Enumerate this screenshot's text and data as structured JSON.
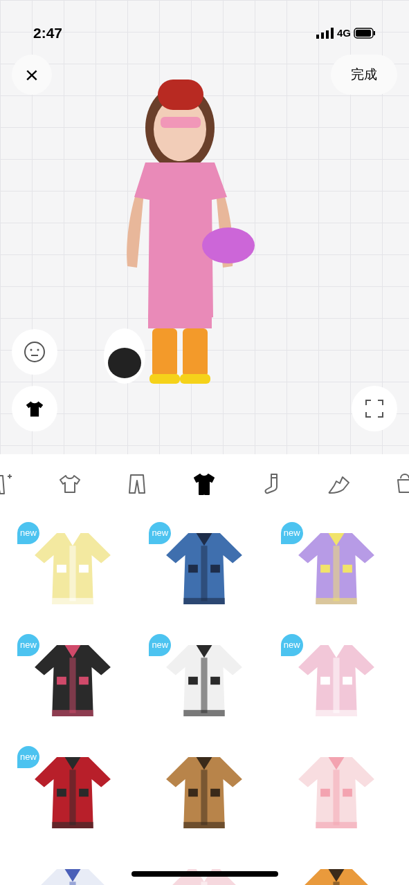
{
  "status_bar": {
    "time": "2:47",
    "network": "4G"
  },
  "top_bar": {
    "close": "×",
    "done": "完成"
  },
  "tabs": [
    {
      "kind": "set",
      "selected": false
    },
    {
      "kind": "shirt",
      "selected": false
    },
    {
      "kind": "pants",
      "selected": false
    },
    {
      "kind": "suit",
      "selected": true
    },
    {
      "kind": "sock",
      "selected": false
    },
    {
      "kind": "shoe",
      "selected": false
    },
    {
      "kind": "bag",
      "selected": false
    }
  ],
  "items": [
    {
      "new": true,
      "badge": "new"
    },
    {
      "new": true,
      "badge": "new"
    },
    {
      "new": true,
      "badge": "new"
    },
    {
      "new": true,
      "badge": "new"
    },
    {
      "new": true,
      "badge": "new"
    },
    {
      "new": true,
      "badge": "new"
    },
    {
      "new": true,
      "badge": "new"
    },
    {
      "new": false
    },
    {
      "new": false
    },
    {
      "new": false
    },
    {
      "new": false
    },
    {
      "new": false
    }
  ]
}
